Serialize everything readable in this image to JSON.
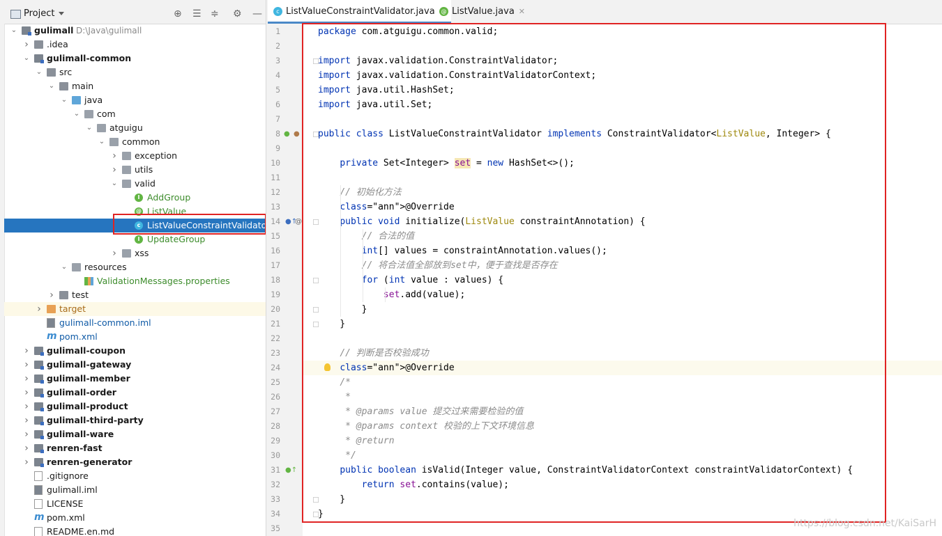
{
  "project_panel": {
    "title": "Project",
    "toolbar_icons": [
      "target-icon",
      "expand-all-icon",
      "collapse-all-icon",
      "gear-icon",
      "minimize-icon"
    ],
    "tree": [
      {
        "label": "gulimall",
        "path": "D:\\Java\\gulimall",
        "icon": "module-folder",
        "depth": 0,
        "expanded": true
      },
      {
        "label": ".idea",
        "icon": "folder",
        "depth": 1,
        "expanded": false
      },
      {
        "label": "gulimall-common",
        "icon": "module-folder",
        "depth": 1,
        "expanded": true
      },
      {
        "label": "src",
        "icon": "folder",
        "depth": 2,
        "expanded": true
      },
      {
        "label": "main",
        "icon": "folder",
        "depth": 3,
        "expanded": true
      },
      {
        "label": "java",
        "icon": "source-folder",
        "depth": 4,
        "expanded": true
      },
      {
        "label": "com",
        "icon": "package",
        "depth": 5,
        "expanded": true
      },
      {
        "label": "atguigu",
        "icon": "package",
        "depth": 6,
        "expanded": true
      },
      {
        "label": "common",
        "icon": "package",
        "depth": 7,
        "expanded": true
      },
      {
        "label": "exception",
        "icon": "package",
        "depth": 8,
        "expanded": false
      },
      {
        "label": "utils",
        "icon": "package",
        "depth": 8,
        "expanded": false
      },
      {
        "label": "valid",
        "icon": "package",
        "depth": 8,
        "expanded": true
      },
      {
        "label": "AddGroup",
        "icon": "interface",
        "depth": 9
      },
      {
        "label": "ListValue",
        "icon": "annotation",
        "depth": 9
      },
      {
        "label": "ListValueConstraintValidator",
        "icon": "class",
        "depth": 9,
        "selected": true
      },
      {
        "label": "UpdateGroup",
        "icon": "interface",
        "depth": 9
      },
      {
        "label": "xss",
        "icon": "package",
        "depth": 8,
        "expanded": false
      },
      {
        "label": "resources",
        "icon": "resources-folder",
        "depth": 4,
        "expanded": true
      },
      {
        "label": "ValidationMessages.properties",
        "icon": "properties-file",
        "depth": 5
      },
      {
        "label": "test",
        "icon": "folder",
        "depth": 3,
        "expanded": false
      },
      {
        "label": "target",
        "icon": "excluded-folder",
        "depth": 2,
        "expanded": false
      },
      {
        "label": "gulimall-common.iml",
        "icon": "iml-file",
        "depth": 2
      },
      {
        "label": "pom.xml",
        "icon": "maven-file",
        "depth": 2
      },
      {
        "label": "gulimall-coupon",
        "icon": "module-folder",
        "depth": 1,
        "expanded": false
      },
      {
        "label": "gulimall-gateway",
        "icon": "module-folder",
        "depth": 1,
        "expanded": false
      },
      {
        "label": "gulimall-member",
        "icon": "module-folder",
        "depth": 1,
        "expanded": false
      },
      {
        "label": "gulimall-order",
        "icon": "module-folder",
        "depth": 1,
        "expanded": false
      },
      {
        "label": "gulimall-product",
        "icon": "module-folder",
        "depth": 1,
        "expanded": false
      },
      {
        "label": "gulimall-third-party",
        "icon": "module-folder",
        "depth": 1,
        "expanded": false
      },
      {
        "label": "gulimall-ware",
        "icon": "module-folder",
        "depth": 1,
        "expanded": false
      },
      {
        "label": "renren-fast",
        "icon": "module-folder",
        "depth": 1,
        "expanded": false
      },
      {
        "label": "renren-generator",
        "icon": "module-folder",
        "depth": 1,
        "expanded": false
      },
      {
        "label": ".gitignore",
        "icon": "text-file",
        "depth": 1
      },
      {
        "label": "gulimall.iml",
        "icon": "iml-file",
        "depth": 1
      },
      {
        "label": "LICENSE",
        "icon": "text-file",
        "depth": 1
      },
      {
        "label": "pom.xml",
        "icon": "maven-file",
        "depth": 1
      },
      {
        "label": "README.en.md",
        "icon": "markdown-file",
        "depth": 1
      }
    ]
  },
  "editor": {
    "tabs": [
      {
        "label": "ListValueConstraintValidator.java",
        "icon": "class-icon",
        "active": true
      },
      {
        "label": "ListValue.java",
        "icon": "annotation-icon",
        "active": false
      }
    ],
    "lines": [
      "package com.atguigu.common.valid;",
      "",
      "import javax.validation.ConstraintValidator;",
      "import javax.validation.ConstraintValidatorContext;",
      "import java.util.HashSet;",
      "import java.util.Set;",
      "",
      "public class ListValueConstraintValidator implements ConstraintValidator<ListValue, Integer> {",
      "",
      "    private Set<Integer> set = new HashSet<>();",
      "",
      "    // 初始化方法",
      "    @Override",
      "    public void initialize(ListValue constraintAnnotation) {",
      "        // 合法的值",
      "        int[] values = constraintAnnotation.values();",
      "        // 将合法值全部放到set中，便于查找是否存在",
      "        for (int value : values) {",
      "            set.add(value);",
      "        }",
      "    }",
      "",
      "    // 判断是否校验成功",
      "    @Override",
      "    /*",
      "     *",
      "     * @params value 提交过来需要检验的值",
      "     * @params context 校验的上下文环境信息",
      "     * @return",
      "     */",
      "    public boolean isValid(Integer value, ConstraintValidatorContext constraintValidatorContext) {",
      "        return set.contains(value);",
      "    }",
      "}",
      ""
    ],
    "current_line": 24,
    "watermark": "https://blog.csdn.net/KaiSarH"
  },
  "colors": {
    "selection": "#2675bf",
    "highlight_box": "#e02323",
    "keyword": "#0033b3",
    "annotation": "#9e880d",
    "comment": "#8c8c8c",
    "field": "#871094"
  }
}
